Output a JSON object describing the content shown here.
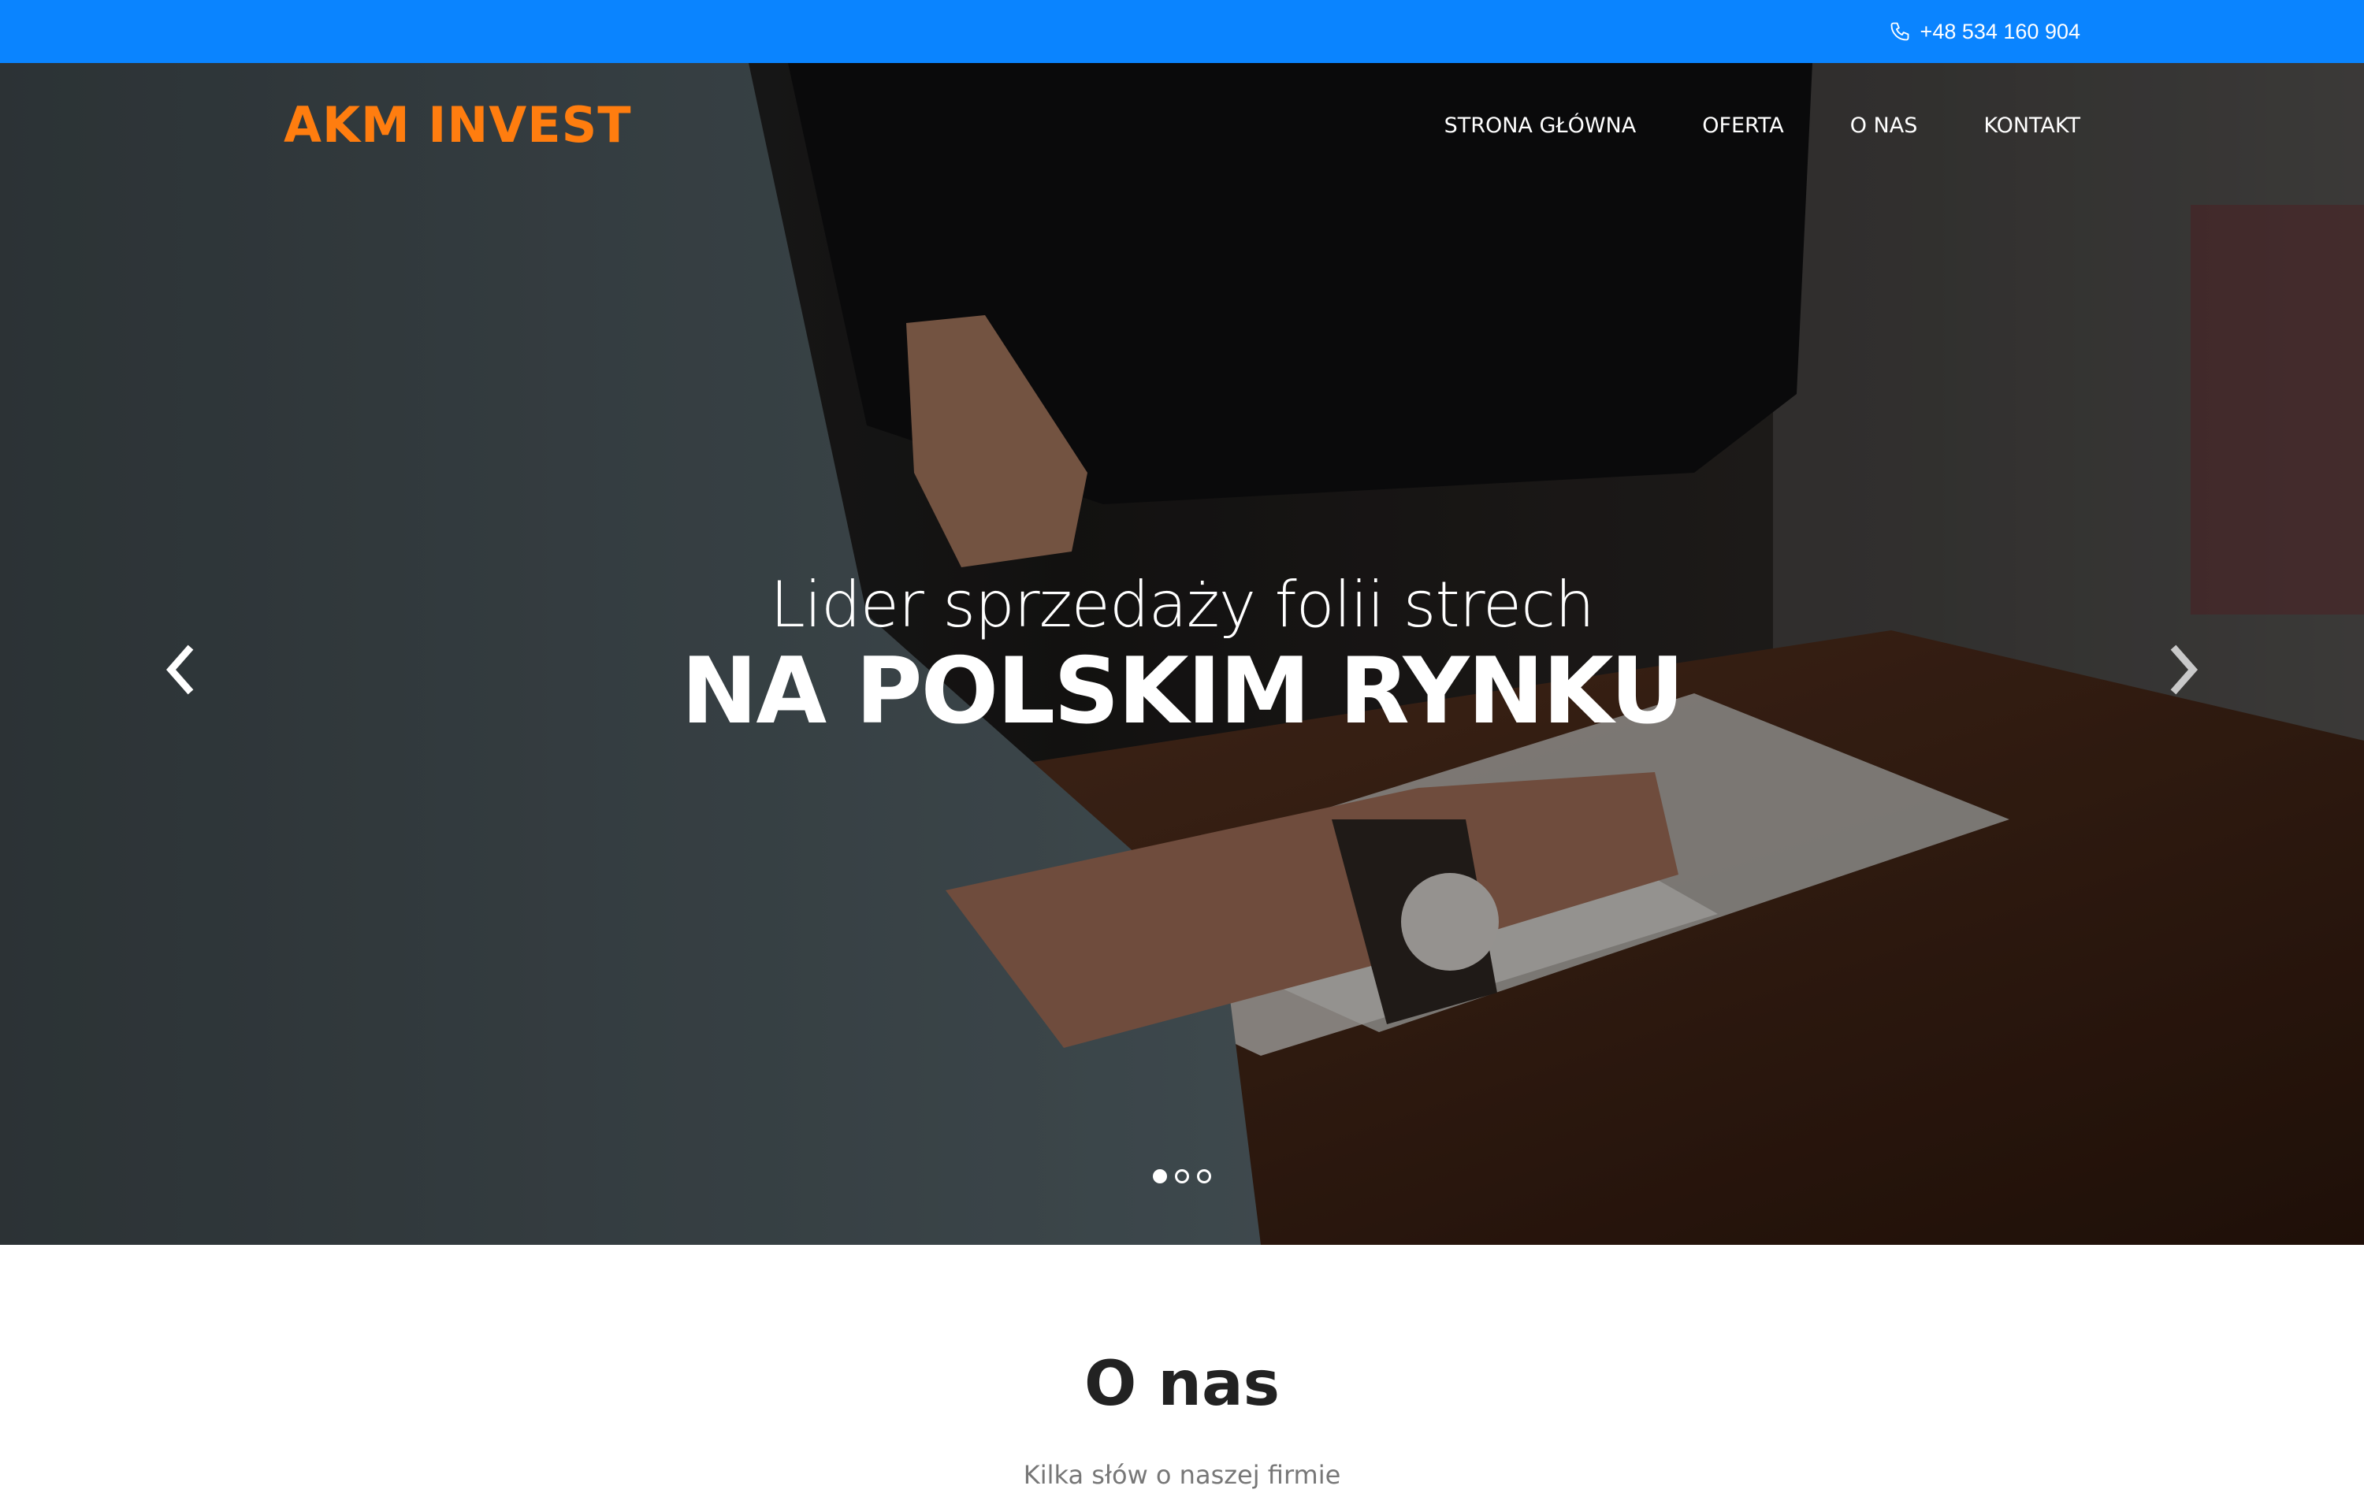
{
  "topbar": {
    "phone_icon": "phone-icon",
    "phone": "+48 534 160 904"
  },
  "header": {
    "logo": "AKM INVEST",
    "nav": [
      "STRONA GŁÓWNA",
      "OFERTA",
      "O NAS",
      "KONTAKT"
    ]
  },
  "hero": {
    "subtitle": "Lider sprzedaży folii strech",
    "title": "NA POLSKIM RYNKU",
    "prev_icon": "chevron-left-icon",
    "next_icon": "chevron-right-icon",
    "slides_total": 3,
    "active_slide": 1
  },
  "about": {
    "title": "O nas",
    "subtitle": "Kilka słów o naszej firmie"
  },
  "colors": {
    "topbar": "#0a84ff",
    "logo": "#ff7d0f",
    "hero_text": "#ffffff",
    "heading": "#222222",
    "muted": "#777777"
  }
}
